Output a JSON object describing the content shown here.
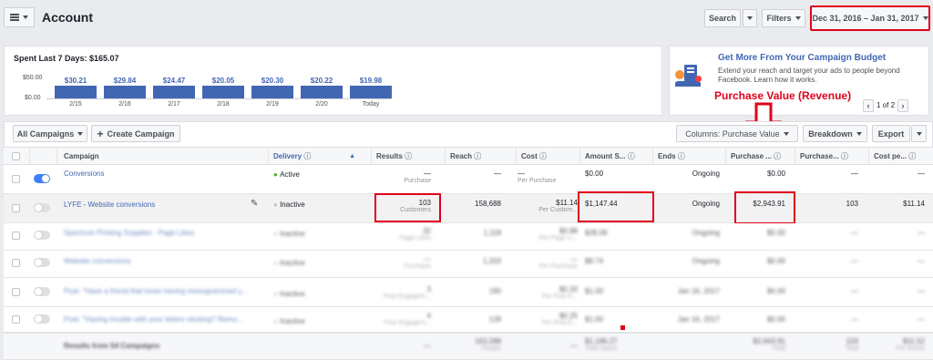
{
  "header": {
    "title": "Account",
    "search": "Search",
    "filters": "Filters",
    "date_range": "Dec 31, 2016 – Jan 31, 2017"
  },
  "spend": {
    "title": "Spent Last 7 Days: $165.07",
    "y_top": "$50.00",
    "y_bottom": "$0.00",
    "values": [
      "$30.21",
      "$29.84",
      "$24.47",
      "$20.05",
      "$20.30",
      "$20.22",
      "$19.98"
    ],
    "dates": [
      "2/15",
      "2/16",
      "2/17",
      "2/18",
      "2/19",
      "2/20",
      "Today"
    ]
  },
  "promo": {
    "title": "Get More From Your Campaign Budget",
    "body": "Extend your reach and target your ads to people beyond Facebook. Learn how it works.",
    "pager": "1 of 2"
  },
  "annotation": "Purchase Value (Revenue)",
  "toolbar": {
    "all_campaigns": "All Campaigns",
    "create": "Create Campaign",
    "columns": "Columns: Purchase Value",
    "breakdown": "Breakdown",
    "export": "Export"
  },
  "columns": [
    "Campaign",
    "Delivery",
    "Results",
    "Reach",
    "Cost",
    "Amount S...",
    "Ends",
    "Purchase ...",
    "Purchase...",
    "Cost pe..."
  ],
  "rows": [
    {
      "name": "Conversions",
      "delivery": "Active",
      "results": "—",
      "results_sub": "Purchase",
      "reach": "—",
      "cost": "—",
      "cost_sub": "Per Purchase",
      "amount": "$0.00",
      "ends": "Ongoing",
      "pv": "$0.00",
      "purch": "—",
      "cpp": "—"
    },
    {
      "name": "LYFE - Website conversions",
      "delivery": "Inactive",
      "results": "103",
      "results_sub": "Customers",
      "reach": "158,688",
      "cost": "$11.14",
      "cost_sub": "Per Custom...",
      "amount": "$1,147.44",
      "ends": "Ongoing",
      "pv": "$2,943.91",
      "purch": "103",
      "cpp": "$11.14"
    },
    {
      "name": "Spectrum Printing Supplies - Page Likes",
      "delivery": "Inactive",
      "results": "32",
      "results_sub": "Page Likes",
      "reach": "1,118",
      "cost": "$0.88",
      "cost_sub": "Per Page Li...",
      "amount": "$28.09",
      "ends": "Ongoing",
      "pv": "$0.00",
      "purch": "—",
      "cpp": "—"
    },
    {
      "name": "Website conversions",
      "delivery": "Inactive",
      "results": "—",
      "results_sub": "Purchase",
      "reach": "1,203",
      "cost": "—",
      "cost_sub": "Per Purchase",
      "amount": "$8.74",
      "ends": "Ongoing",
      "pv": "$0.00",
      "purch": "—",
      "cpp": "—"
    },
    {
      "name": "Post: \"Have a friend that loves having monogrammed y...",
      "delivery": "Inactive",
      "results": "3",
      "results_sub": "Post Engagem...",
      "reach": "190",
      "cost": "$0.33",
      "cost_sub": "Per Post E...",
      "amount": "$1.00",
      "ends": "Jan 16, 2017",
      "pv": "$0.00",
      "purch": "—",
      "cpp": "—"
    },
    {
      "name": "Post: \"Having trouble with your letters sticking? Remo...",
      "delivery": "Inactive",
      "results": "4",
      "results_sub": "Post Engagem...",
      "reach": "128",
      "cost": "$0.25",
      "cost_sub": "Per Post E...",
      "amount": "$1.00",
      "ends": "Jan 16, 2017",
      "pv": "$0.00",
      "purch": "—",
      "cpp": "—"
    }
  ],
  "totals": {
    "name": "Results from 54 Campaigns",
    "results": "—",
    "reach": "163,288",
    "reach_sub": "People",
    "cost": "—",
    "amount": "$1,186.27",
    "amount_sub": "Total Spent",
    "pv": "$2,943.91",
    "pv_sub": "Total",
    "purch": "103",
    "purch_sub": "Total",
    "cpp": "$11.52",
    "cpp_sub": "Per Action"
  }
}
